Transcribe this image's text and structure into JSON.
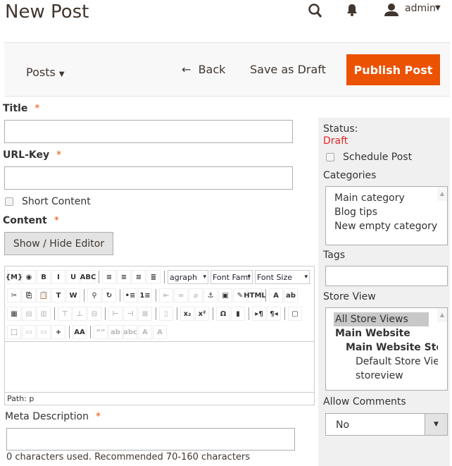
{
  "header": {
    "title": "New Post",
    "user": "admin",
    "icons": [
      "search-icon",
      "bell-icon",
      "user-icon"
    ]
  },
  "actions": {
    "posts": "Posts",
    "back": "Back",
    "save_draft": "Save as Draft",
    "publish": "Publish Post",
    "accent": "#eb5202"
  },
  "form": {
    "title_label": "Title",
    "url_label": "URL-Key",
    "short_content": "Short Content",
    "content_label": "Content",
    "toggle_editor": "Show / Hide Editor",
    "required": "*",
    "editor": {
      "format_select": "agraph",
      "font_family": "Font Fami",
      "font_size": "Font Size",
      "path": "Path: p",
      "rows": [
        [
          "variable",
          "widget",
          "B",
          "I",
          "U",
          "ABC",
          "|",
          "align-left",
          "align-center",
          "align-right",
          "align-justify",
          "|"
        ],
        [
          "cut",
          "copy",
          "paste",
          "paste-text",
          "paste-word",
          "|",
          "find",
          "replace",
          "|",
          "bullet-list",
          "number-list",
          "|",
          "outdent",
          "link",
          "unlink",
          "anchor",
          "image",
          "cleanup",
          "HTML",
          "|",
          "text-color",
          "highlight"
        ],
        [
          "table",
          "row-props",
          "cell-props",
          "|",
          "row-before",
          "row-after",
          "delete-row",
          "|",
          "col-before",
          "col-after",
          "delete-col",
          "|",
          "split",
          "|",
          "x₂",
          "x²",
          "|",
          "Ω",
          "media",
          "|",
          "ltr",
          "rtl",
          "|",
          "fullscreen"
        ],
        [
          "visual-aid",
          "layer-front",
          "layer-back",
          "insert-layer",
          "|",
          "styles",
          "|",
          "cite",
          "abbr",
          "acronym",
          "del",
          "ins"
        ]
      ]
    },
    "meta_label": "Meta Description",
    "meta_help": "0 characters used. Recommended 70-160 characters"
  },
  "sidebar": {
    "status_label": "Status:",
    "status_value": "Draft",
    "status_color": "#e22626",
    "schedule": "Schedule Post",
    "categories_label": "Categories",
    "categories": [
      "Main category",
      "Blog tips",
      "New empty category"
    ],
    "tags_label": "Tags",
    "store_view_label": "Store View",
    "store_views": [
      "All Store Views",
      "Main Website",
      "Main Website Store",
      "Default Store View",
      "storeview"
    ],
    "allow_comments_label": "Allow Comments",
    "allow_comments_value": "No"
  }
}
